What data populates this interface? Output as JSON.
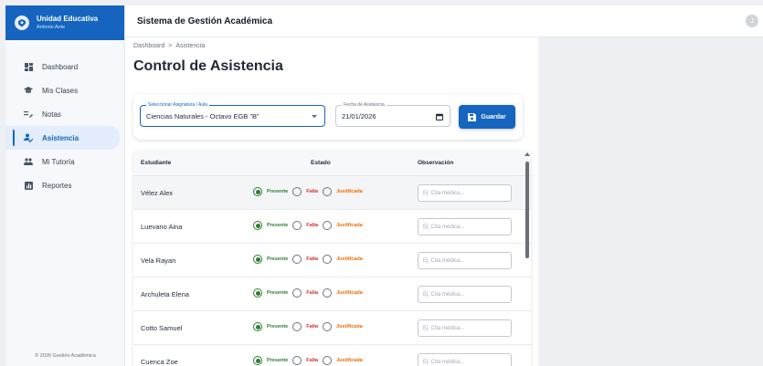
{
  "brand": {
    "title": "Unidad Educativa",
    "subtitle": "Antonio Ante",
    "logo_icon": "school-crest-icon"
  },
  "sidebar": {
    "items": [
      {
        "label": "Dashboard",
        "icon": "dashboard-icon",
        "active": false
      },
      {
        "label": "Mis Clases",
        "icon": "graduation-cap-icon",
        "active": false
      },
      {
        "label": "Notas",
        "icon": "grade-edit-icon",
        "active": false
      },
      {
        "label": "Asistencia",
        "icon": "attendance-icon",
        "active": true
      },
      {
        "label": "Mi Tutoría",
        "icon": "group-icon",
        "active": false
      },
      {
        "label": "Reportes",
        "icon": "report-icon",
        "active": false
      }
    ],
    "footer": "© 2026 Gestión Académica"
  },
  "header": {
    "title": "Sistema de Gestión Académica",
    "avatar_letter": "J"
  },
  "breadcrumb": {
    "parent": "Dashboard",
    "separator": ">",
    "current": "Asistencia"
  },
  "page": {
    "title": "Control de Asistencia"
  },
  "filters": {
    "subject_label": "Seleccionar Asignatura / Aula",
    "subject_value": "Ciencias Naturales - Octavo EGB \"B\"",
    "date_label": "Fecha de Asistencia",
    "date_value": "21/01/2026",
    "save_label": "Guardar"
  },
  "table": {
    "columns": {
      "student": "Estudiante",
      "status": "Estado",
      "observation": "Observación"
    },
    "options": {
      "present": "Presente",
      "absent": "Falta",
      "justified": "Justificada"
    },
    "observation_placeholder": "Ej: Cita médica...",
    "rows": [
      {
        "name": "Vélez Alex",
        "status": "present"
      },
      {
        "name": "Luevano Aina",
        "status": "present"
      },
      {
        "name": "Vela Rayan",
        "status": "present"
      },
      {
        "name": "Archuleta Elena",
        "status": "present"
      },
      {
        "name": "Cotto Samuel",
        "status": "present"
      },
      {
        "name": "Cuenca Zoe",
        "status": "present"
      }
    ]
  },
  "colors": {
    "primary": "#1565c0",
    "present": "#2e7d32",
    "absent": "#d32f2f",
    "justified": "#ef6c00"
  }
}
